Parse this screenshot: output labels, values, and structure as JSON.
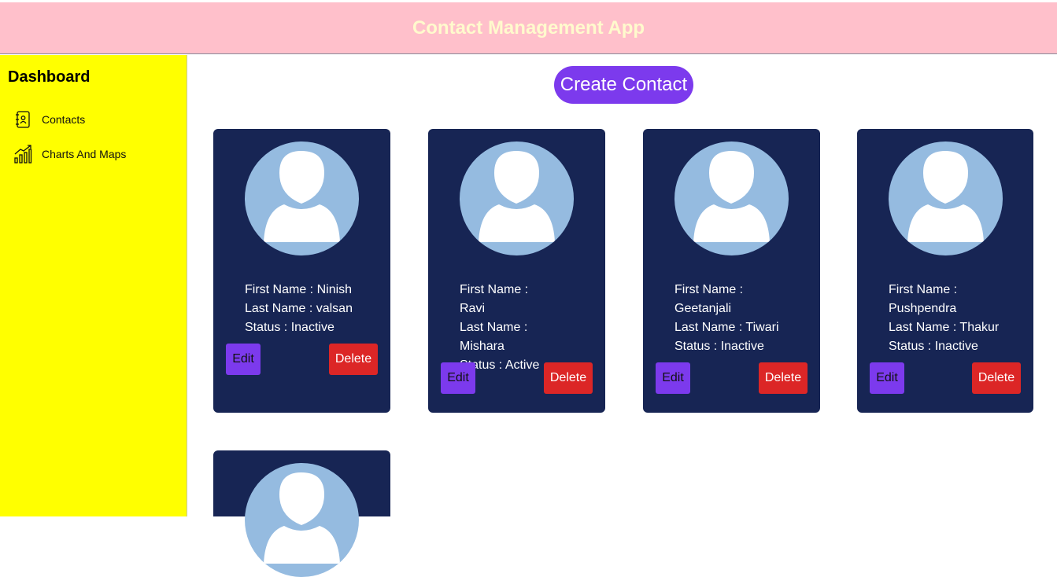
{
  "header": {
    "title": "Contact Management App"
  },
  "sidebar": {
    "title": "Dashboard",
    "items": [
      {
        "label": "Contacts",
        "icon": "contact-book-icon"
      },
      {
        "label": "Charts And Maps",
        "icon": "bar-chart-icon"
      }
    ]
  },
  "main": {
    "create_label": "Create Contact",
    "edit_label": "Edit",
    "delete_label": "Delete",
    "contacts": [
      {
        "first_label": "First Name :",
        "first_name": "Ninish",
        "last_label": "Last Name :",
        "last_name": "valsan",
        "status_label": "Status :",
        "status": "Inactive"
      },
      {
        "first_label": "First Name :",
        "first_name": "Ravi",
        "last_label": "Last Name :",
        "last_name": "Mishara",
        "status_label": "Status :",
        "status": "Active"
      },
      {
        "first_label": "First Name :",
        "first_name": "Geetanjali",
        "last_label": "Last Name :",
        "last_name": "Tiwari",
        "status_label": "Status :",
        "status": "Inactive"
      },
      {
        "first_label": "First Name :",
        "first_name": "Pushpendra",
        "last_label": "Last Name :",
        "last_name": "Thakur",
        "status_label": "Status :",
        "status": "Inactive"
      }
    ]
  },
  "colors": {
    "header_bg": "#ffc0cb",
    "header_text": "#fffacd",
    "sidebar_bg": "#ffff00",
    "card_bg": "#172554",
    "avatar_bg": "#95bbe0",
    "accent": "#7c3aed",
    "danger": "#dc2626"
  }
}
